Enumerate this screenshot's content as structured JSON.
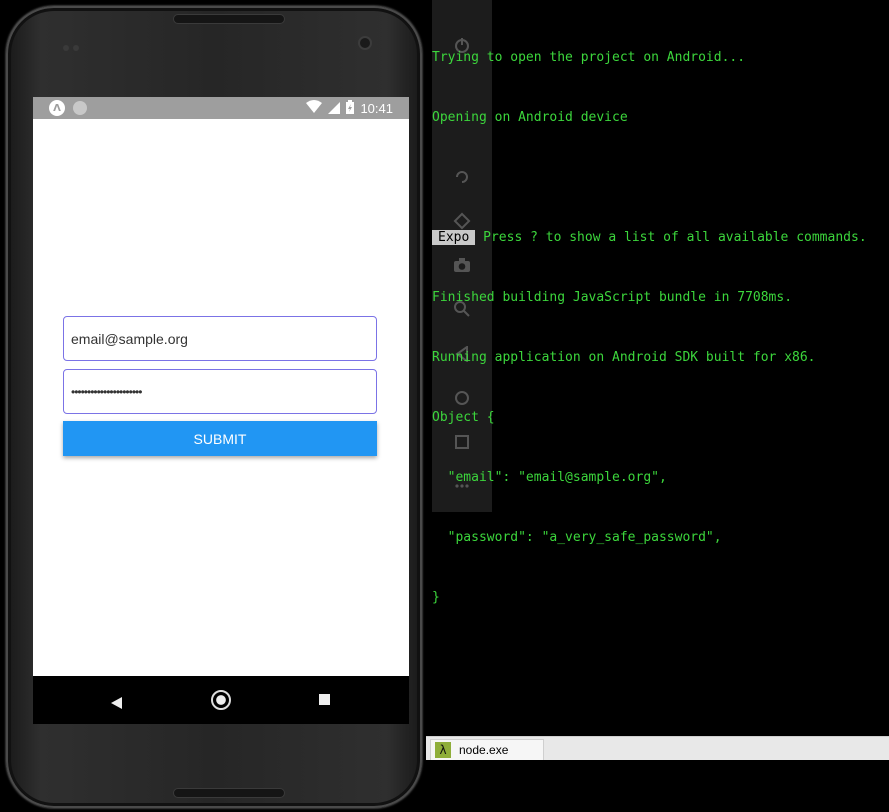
{
  "status_bar": {
    "time": "10:41",
    "left_icon_glyph": "Λ"
  },
  "form": {
    "email_value": "email@sample.org",
    "password_masked": "••••••••••••••••••••••",
    "submit_label": "SUBMIT"
  },
  "terminal": {
    "lines": [
      "Trying to open the project on Android...",
      "Opening on Android device",
      "",
      "",
      "Finished building JavaScript bundle in 7708ms.",
      "Running application on Android SDK built for x86.",
      "Object {",
      "  \"email\": \"email@sample.org\",",
      "  \"password\": \"a_very_safe_password\",",
      "}"
    ],
    "expo_badge": "Expo",
    "expo_line_rest": " Press ? to show a list of all available commands."
  },
  "taskbar": {
    "tab_icon": "λ",
    "tab_label": "node.exe"
  },
  "colors": {
    "terminal_text": "#3cd63c",
    "submit_bg": "#2196f3",
    "input_border": "#7b73e6",
    "status_bar_bg": "#9e9e9e"
  },
  "icons": {
    "toolbar": [
      "power-icon",
      "volume-up-icon",
      "volume-down-icon",
      "rotate-left-icon",
      "rotate-right-icon",
      "camera-icon",
      "zoom-icon",
      "back-icon",
      "home-icon",
      "overview-icon",
      "more-icon"
    ]
  }
}
